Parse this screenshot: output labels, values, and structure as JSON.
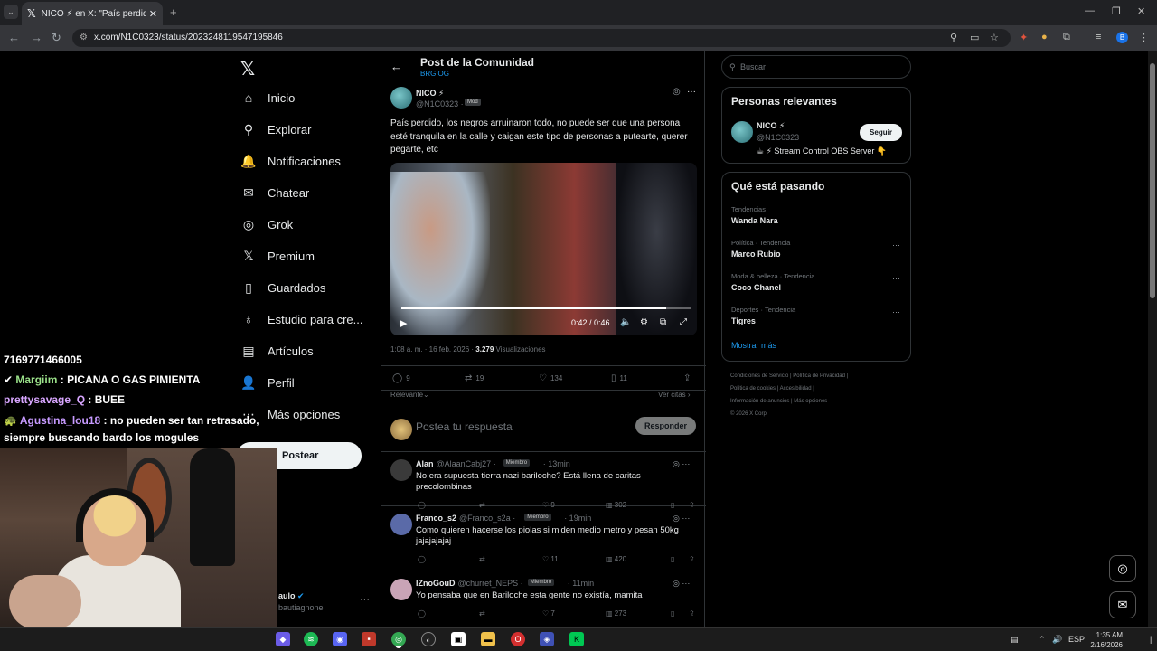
{
  "browser": {
    "tab_title": "NICO ⚡ en X: \"País perdido, lo",
    "url": "x.com/N1C0323/status/2023248119547195846"
  },
  "nav": {
    "items": [
      {
        "label": "Inicio",
        "icon": "home-icon",
        "glyph": "⌂"
      },
      {
        "label": "Explorar",
        "icon": "search-icon",
        "glyph": "⚲"
      },
      {
        "label": "Notificaciones",
        "icon": "bell-icon",
        "glyph": "🔔"
      },
      {
        "label": "Chatear",
        "icon": "mail-icon",
        "glyph": "✉"
      },
      {
        "label": "Grok",
        "icon": "grok-icon",
        "glyph": "◎"
      },
      {
        "label": "Premium",
        "icon": "x-premium-icon",
        "glyph": "𝕏"
      },
      {
        "label": "Guardados",
        "icon": "bookmark-icon",
        "glyph": "▯"
      },
      {
        "label": "Estudio para cre...",
        "icon": "studio-icon",
        "glyph": "♁"
      },
      {
        "label": "Artículos",
        "icon": "articles-icon",
        "glyph": "▤"
      },
      {
        "label": "Perfil",
        "icon": "profile-icon",
        "glyph": "👤"
      },
      {
        "label": "Más opciones",
        "icon": "more-options-icon",
        "glyph": "⋯"
      }
    ],
    "post_button": "Postear",
    "account_name": "aulo",
    "account_handle": "bautiagnone"
  },
  "post": {
    "header_title": "Post de la Comunidad",
    "header_subtitle": "BRG OG",
    "author_name": "NICO ⚡",
    "author_handle": "@N1C0323 ·",
    "badge": "Mod",
    "text": "País perdido, los negros arruinaron todo, no puede ser que una persona esté tranquila en la calle y caigan este tipo de personas a putearte, querer pegarte, etc",
    "video_time": "0:42 / 0:46",
    "video_progress": 0.913,
    "timestamp": "1:08 a. m. · 16 feb. 2026 · ",
    "views_count": "3.279",
    "views_label": " Visualizaciones",
    "replies": "9",
    "reposts": "19",
    "likes": "134",
    "bookmarks": "11",
    "sort_label": "Relevante",
    "quotes_label": "Ver citas ›",
    "reply_placeholder": "Postea tu respuesta",
    "reply_button": "Responder"
  },
  "replies": [
    {
      "name": "Alan",
      "handle": "@AlaanCabj27 ·",
      "badge": "Miembro",
      "time": "· 13min",
      "text": "No era supuesta tierra nazi bariloche? Está llena de caritas precolombinas",
      "likes": "9",
      "views": "302",
      "avatar_color": "#3a3a3a"
    },
    {
      "name": "Franco_s2",
      "handle": "@Franco_s2a ·",
      "badge": "Miembro",
      "time": "· 19min",
      "text": "Como quieren hacerse los piolas si miden medio metro y pesan 50kg jajajajajaj",
      "likes": "11",
      "views": "420",
      "avatar_color": "#5a6aa8"
    },
    {
      "name": "IZnoGouD",
      "handle": "@churret_NEPS ·",
      "badge": "Miembro",
      "time": "· 11min",
      "text": "Yo pensaba que en Bariloche esta gente no existía, mamita",
      "likes": "7",
      "views": "273",
      "avatar_color": "#c9a4b6"
    }
  ],
  "sidebar": {
    "search_placeholder": "Buscar",
    "relevant_title": "Personas relevantes",
    "person_name": "NICO ⚡",
    "person_handle": "@N1C0323",
    "person_bio": "☕ ⚡ Stream Control OBS Server 👇",
    "follow_label": "Seguir",
    "trending_title": "Qué está pasando",
    "trends": [
      {
        "category": "Tendencias",
        "name": "Wanda Nara"
      },
      {
        "category": "Política · Tendencia",
        "name": "Marco Rubio"
      },
      {
        "category": "Moda & belleza · Tendencia",
        "name": "Coco Chanel"
      },
      {
        "category": "Deportes · Tendencia",
        "name": "Tigres"
      }
    ],
    "show_more": "Mostrar más",
    "footer_lines": [
      "Condiciones de Servicio  |  Política de Privacidad  |",
      "Política de cookies  |  Accesibilidad  |",
      "Información de anuncios  |  Más opciones ···",
      "© 2026 X Corp."
    ]
  },
  "stream_chat": [
    {
      "user": "",
      "msg": "7169771466005",
      "color": "#ffffff"
    },
    {
      "user": "Margiim",
      "msg": " : PICANA O GAS PIMIENTA",
      "color": "#9be28a",
      "prefix": "✔ "
    },
    {
      "user": "prettysavage_Q",
      "msg": " : BUEE",
      "color": "#d8a6ff"
    },
    {
      "user": "Agustina_lou18",
      "msg": " : no pueden ser tan retrasado,",
      "color": "#c79aff",
      "prefix": "🐢 "
    },
    {
      "user": "",
      "msg": "siempre buscando bardo los mogules",
      "color": "#ffffff"
    }
  ],
  "taskbar": {
    "lang": "ESP",
    "time": "1:35 AM",
    "date": "2/16/2026"
  }
}
